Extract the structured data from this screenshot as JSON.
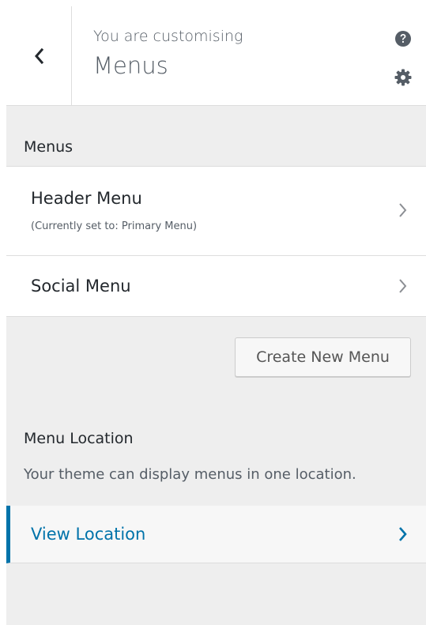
{
  "header": {
    "subtitle": "You are customising",
    "title": "Menus"
  },
  "section": {
    "title": "Menus"
  },
  "menus": [
    {
      "title": "Header Menu",
      "description": "(Currently set to: Primary Menu)"
    },
    {
      "title": "Social Menu"
    }
  ],
  "create_button": {
    "label": "Create New Menu"
  },
  "location": {
    "title": "Menu Location",
    "description": "Your theme can display menus in one location.",
    "view_label": "View Location"
  },
  "icons": {
    "back": "chevron-left-icon",
    "help": "help-icon",
    "settings": "gear-icon",
    "item_arrow": "chevron-right-icon"
  },
  "colors": {
    "accent": "#0073aa",
    "panel_bg": "#eeeeee",
    "text": "#23282d",
    "muted": "#555d66"
  }
}
